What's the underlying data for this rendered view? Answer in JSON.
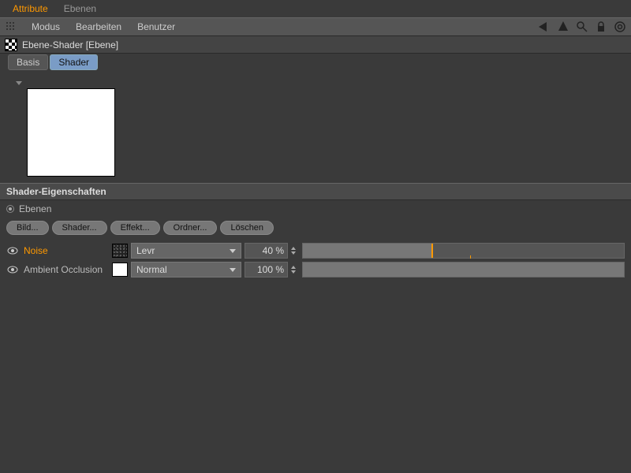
{
  "topTabs": {
    "attribute": "Attribute",
    "ebenen": "Ebenen"
  },
  "menu": {
    "modus": "Modus",
    "bearbeiten": "Bearbeiten",
    "benutzer": "Benutzer"
  },
  "object": {
    "title": "Ebene-Shader [Ebene]"
  },
  "subTabs": {
    "basis": "Basis",
    "shader": "Shader"
  },
  "section": {
    "title": "Shader-Eigenschaften",
    "ebenen": "Ebenen"
  },
  "buttons": {
    "bild": "Bild...",
    "shader": "Shader...",
    "effekt": "Effekt...",
    "ordner": "Ordner...",
    "loeschen": "Löschen"
  },
  "layers": [
    {
      "name": "Noise",
      "accent": true,
      "swatch": "noise",
      "mode": "Levr",
      "percent": "40 %",
      "value": 40,
      "mark": 52
    },
    {
      "name": "Ambient Occlusion",
      "accent": false,
      "swatch": "white",
      "mode": "Normal",
      "percent": "100 %",
      "value": 100,
      "mark": null
    }
  ]
}
